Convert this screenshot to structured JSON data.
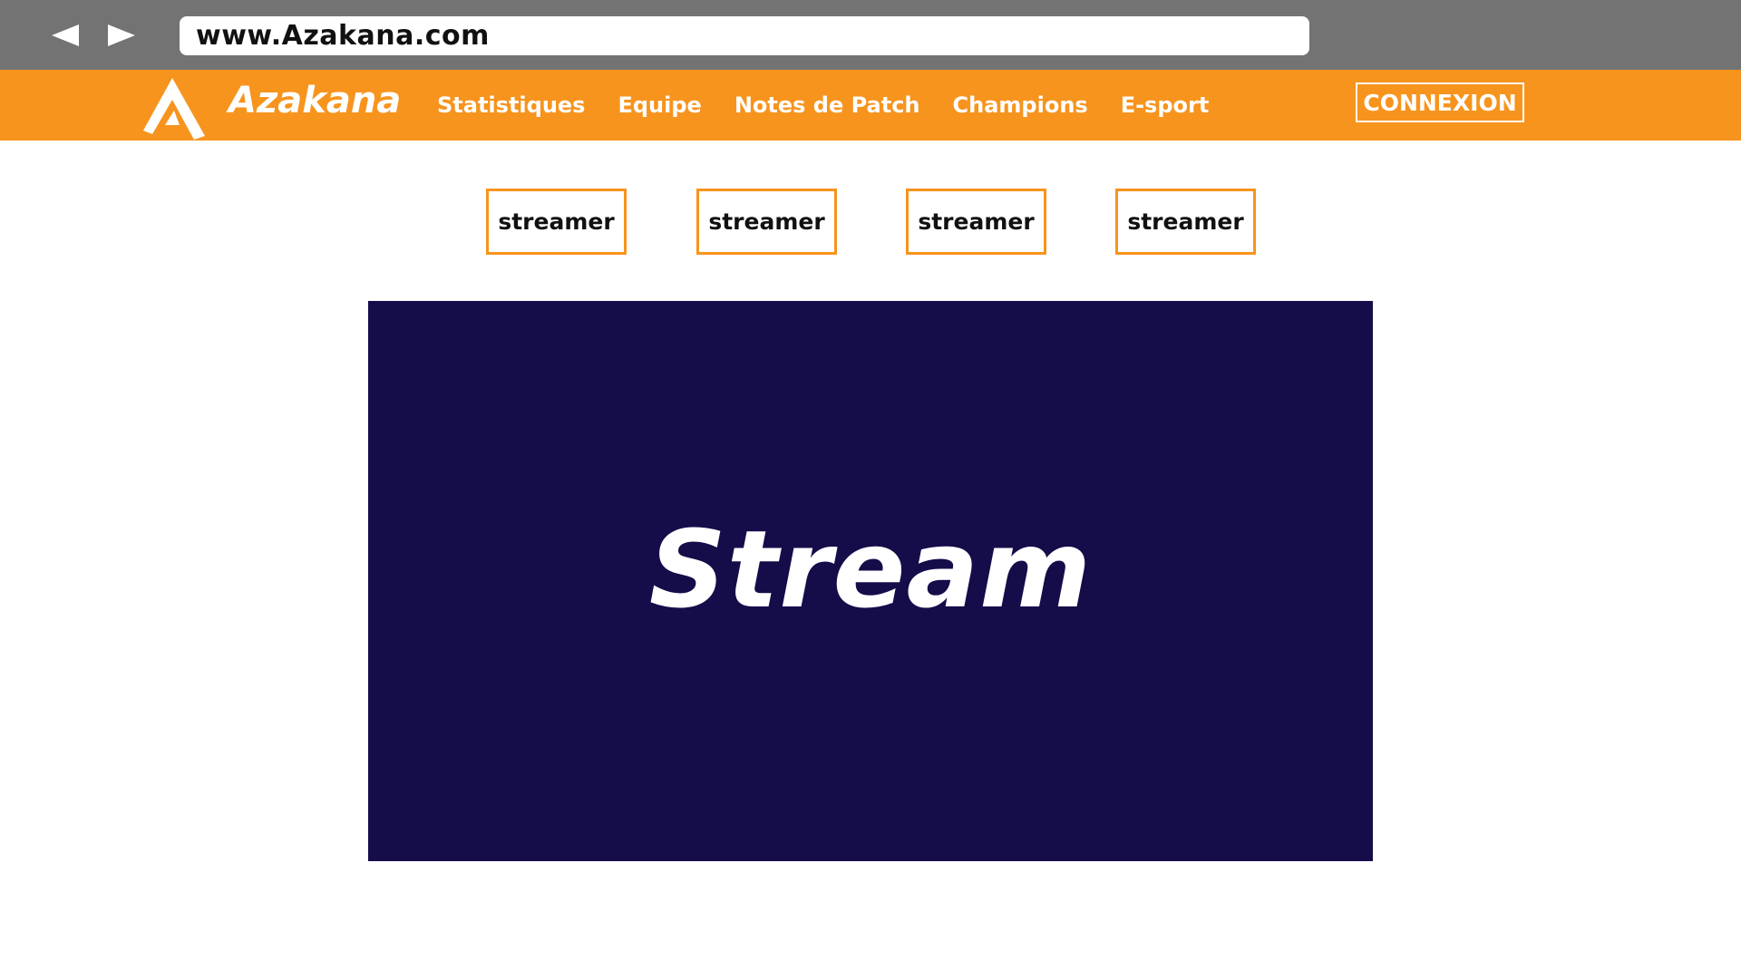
{
  "browser": {
    "url": "www.Azakana.com",
    "back_icon": "back-arrow-icon",
    "forward_icon": "forward-arrow-icon"
  },
  "header": {
    "brand": "Azakana",
    "logo_icon": "azakana-logo-icon",
    "nav": [
      {
        "label": "Statistiques"
      },
      {
        "label": "Equipe"
      },
      {
        "label": "Notes de Patch"
      },
      {
        "label": "Champions"
      },
      {
        "label": "E-sport"
      }
    ],
    "login_label": "CONNEXION"
  },
  "streamers": [
    {
      "label": "streamer"
    },
    {
      "label": "streamer"
    },
    {
      "label": "streamer"
    },
    {
      "label": "streamer"
    }
  ],
  "stream": {
    "title": "Stream"
  },
  "colors": {
    "browser_bar": "#737373",
    "accent": "#f7941d",
    "stream_bg": "#150c4a",
    "text_light": "#ffffff",
    "text_dark": "#111111"
  }
}
